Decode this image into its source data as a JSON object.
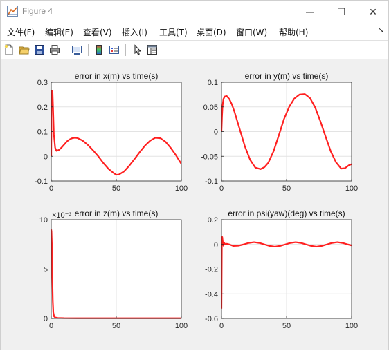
{
  "window": {
    "title": "Figure 4",
    "controls": {
      "minimize": "—",
      "maximize": "☐",
      "close": "✕"
    }
  },
  "menu": {
    "items": [
      "文件(F)",
      "编辑(E)",
      "查看(V)",
      "插入(I)",
      "工具(T)",
      "桌面(D)",
      "窗口(W)",
      "帮助(H)"
    ],
    "overflow_glyph": "↘"
  },
  "toolbar": {
    "buttons": [
      {
        "icon": "new-figure-icon"
      },
      {
        "icon": "open-file-icon"
      },
      {
        "icon": "save-icon"
      },
      {
        "icon": "print-icon"
      },
      {
        "icon": "link-plot-icon"
      },
      {
        "icon": "insert-colorbar-icon"
      },
      {
        "icon": "insert-legend-icon"
      },
      {
        "icon": "edit-plot-pointer-icon"
      },
      {
        "icon": "property-inspector-icon"
      }
    ]
  },
  "colors": {
    "line": "#ff2020",
    "grid": "#e3e3e3",
    "axes_bg": "#ffffff",
    "figure_bg": "#f0f0f0"
  },
  "chart_data": [
    {
      "type": "line",
      "title": "error in x(m) vs time(s)",
      "xlim": [
        0,
        100
      ],
      "ylim": [
        -0.1,
        0.3
      ],
      "xticks": [
        0,
        50,
        100
      ],
      "xtick_labels": [
        "0",
        "50",
        "100"
      ],
      "yticks": [
        -0.1,
        0,
        0.1,
        0.2,
        0.3
      ],
      "ytick_labels": [
        "-0.1",
        "0",
        "0.1",
        "0.2",
        "0.3"
      ],
      "exponent_label": "",
      "grid": true,
      "series": [
        {
          "x": [
            0,
            0.3,
            0.6,
            1.0,
            1.5,
            2,
            3,
            4,
            6,
            8,
            10,
            12,
            14,
            16,
            18,
            20,
            24,
            28,
            32,
            36,
            40,
            44,
            48,
            50,
            52,
            56,
            60,
            64,
            68,
            72,
            76,
            80,
            84,
            88,
            92,
            96,
            100
          ],
          "y": [
            0.0,
            0.24,
            0.265,
            0.26,
            0.18,
            0.09,
            0.035,
            0.022,
            0.026,
            0.036,
            0.048,
            0.06,
            0.068,
            0.073,
            0.075,
            0.074,
            0.064,
            0.047,
            0.025,
            0.001,
            -0.027,
            -0.051,
            -0.068,
            -0.075,
            -0.074,
            -0.061,
            -0.038,
            -0.011,
            0.017,
            0.043,
            0.063,
            0.075,
            0.073,
            0.058,
            0.033,
            0.003,
            -0.031
          ]
        }
      ]
    },
    {
      "type": "line",
      "title": "error in y(m) vs time(s)",
      "xlim": [
        0,
        100
      ],
      "ylim": [
        -0.1,
        0.1
      ],
      "xticks": [
        0,
        50,
        100
      ],
      "xtick_labels": [
        "0",
        "50",
        "100"
      ],
      "yticks": [
        -0.1,
        -0.05,
        0,
        0.05,
        0.1
      ],
      "ytick_labels": [
        "-0.1",
        "-0.05",
        "0",
        "0.05",
        "0.1"
      ],
      "exponent_label": "",
      "grid": true,
      "series": [
        {
          "x": [
            0,
            0.4,
            0.8,
            1.5,
            2.5,
            4,
            6,
            8,
            10,
            14,
            18,
            22,
            26,
            30,
            33,
            36,
            40,
            44,
            48,
            52,
            56,
            60,
            64,
            68,
            72,
            76,
            80,
            84,
            88,
            92,
            95,
            98,
            100
          ],
          "y": [
            0.0,
            0.03,
            0.052,
            0.066,
            0.071,
            0.072,
            0.066,
            0.055,
            0.04,
            0.005,
            -0.03,
            -0.057,
            -0.073,
            -0.076,
            -0.072,
            -0.063,
            -0.04,
            -0.008,
            0.025,
            0.05,
            0.067,
            0.075,
            0.076,
            0.068,
            0.049,
            0.021,
            -0.01,
            -0.04,
            -0.062,
            -0.075,
            -0.074,
            -0.068,
            -0.066
          ]
        }
      ]
    },
    {
      "type": "line",
      "title": "error in z(m) vs time(s)",
      "xlim": [
        0,
        100
      ],
      "ylim": [
        0,
        0.01
      ],
      "xticks": [
        0,
        50,
        100
      ],
      "xtick_labels": [
        "0",
        "50",
        "100"
      ],
      "yticks": [
        0,
        0.005,
        0.01
      ],
      "ytick_labels": [
        "0",
        "5",
        "10"
      ],
      "exponent_label": "×10⁻³",
      "grid": true,
      "series": [
        {
          "x": [
            0,
            0.2,
            0.5,
            0.8,
            1.2,
            1.6,
            2.2,
            3,
            5,
            10,
            20,
            40,
            60,
            80,
            100
          ],
          "y": [
            0.009,
            0.0088,
            0.0075,
            0.0045,
            0.0018,
            0.0006,
            0.0002,
            0.0001,
            5e-05,
            3e-05,
            2e-05,
            2e-05,
            2e-05,
            2e-05,
            2e-05
          ]
        }
      ]
    },
    {
      "type": "line",
      "title": "error in psi(yaw)(deg) vs time(s)",
      "xlim": [
        0,
        100
      ],
      "ylim": [
        -0.6,
        0.2
      ],
      "xticks": [
        0,
        50,
        100
      ],
      "xtick_labels": [
        "0",
        "50",
        "100"
      ],
      "yticks": [
        -0.6,
        -0.4,
        -0.2,
        0,
        0.2
      ],
      "ytick_labels": [
        "-0.6",
        "-0.4",
        "-0.2",
        "0",
        "0.2"
      ],
      "exponent_label": "",
      "grid": true,
      "series": [
        {
          "x": [
            0,
            0.3,
            0.6,
            1.0,
            1.5,
            2.2,
            3,
            4,
            6,
            9,
            13,
            17,
            21,
            25,
            29,
            33,
            37,
            41,
            45,
            49,
            53,
            57,
            61,
            65,
            69,
            73,
            77,
            81,
            85,
            89,
            93,
            97,
            100
          ],
          "y": [
            -0.52,
            0.05,
            0.06,
            0.02,
            -0.01,
            0.01,
            0.0,
            0.005,
            0.0,
            -0.012,
            -0.01,
            0.0,
            0.012,
            0.018,
            0.012,
            0.0,
            -0.012,
            -0.018,
            -0.012,
            0.0,
            0.012,
            0.018,
            0.012,
            0.0,
            -0.012,
            -0.018,
            -0.012,
            0.0,
            0.012,
            0.018,
            0.012,
            0.0,
            -0.008
          ]
        }
      ]
    }
  ]
}
